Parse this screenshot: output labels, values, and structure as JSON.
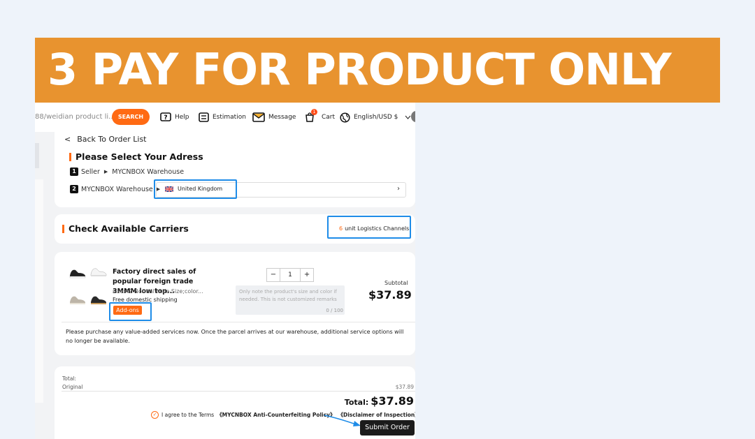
{
  "banner": {
    "title": "3 PAY FOR PRODUCT ONLY"
  },
  "header": {
    "search_placeholder": "88/weidian product li...",
    "search_button": "SEARCH",
    "help": "Help",
    "estimation": "Estimation",
    "message": "Message",
    "cart": "Cart",
    "cart_count": "1",
    "language": "English/USD $"
  },
  "address": {
    "back_label": "Back To Order List",
    "title": "Please Select Your Adress",
    "step1_num": "1",
    "step1_from": "Seller",
    "step1_to": "MYCNBOX Warehouse",
    "step2_num": "2",
    "step2_from": "MYCNBOX Warehouse",
    "country": "United Kingdom"
  },
  "carriers": {
    "title": "Check Available Carriers",
    "count": "6",
    "channels_label": "unit Logistics Channels"
  },
  "product": {
    "title": "Factory direct sales of popular foreign trade 3MMM low top...",
    "spec": "size:42 Normal Male Size;color...",
    "shipping": "Free domestic shipping",
    "addons": "Add-ons",
    "qty": "1",
    "minus": "−",
    "plus": "+",
    "remarks_placeholder": "Only note the product's size and color if needed. This is not customized remarks",
    "remarks_count": "0 / 100",
    "subtotal_label": "Subtotal",
    "subtotal_value": "$37.89",
    "notice": "Please purchase any value-added services now. Once the parcel arrives at our warehouse, additional service options will no longer be available."
  },
  "summary": {
    "total_label": "Total:",
    "original_label": "Original",
    "original_value": "$37.89",
    "grand_label": "Total:",
    "grand_value": "$37.89",
    "terms_prefix": "I agree to the Terms",
    "policy": "《MYCNBOX Anti-Counterfeiting Policy》",
    "disclaimer": "《Disclaimer of Inspection》",
    "submit": "Submit Order"
  },
  "colors": {
    "banner": "#e8932f",
    "accent": "#ff6a13",
    "highlight": "#1e8ce8"
  },
  "icons": [
    "help-icon",
    "estimation-icon",
    "message-icon",
    "cart-icon",
    "globe-icon",
    "chevron-down-icon",
    "chevron-left-icon",
    "chevron-right-icon",
    "uk-flag-icon",
    "check-circle-icon"
  ]
}
